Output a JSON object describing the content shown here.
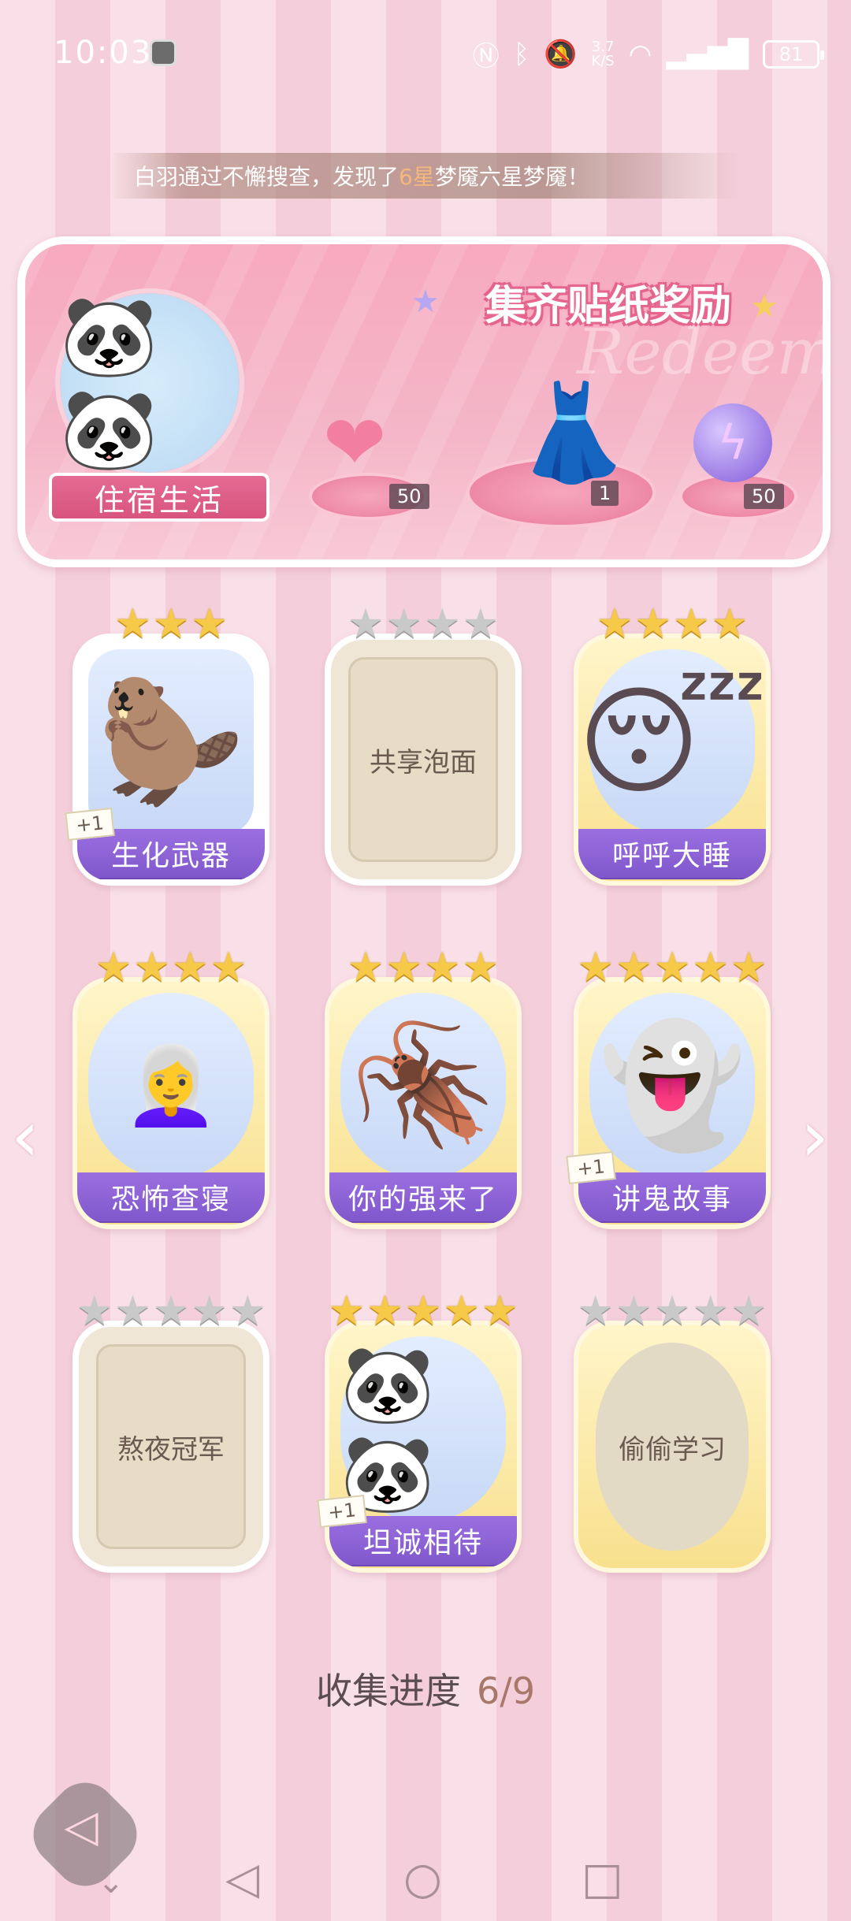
{
  "status_bar": {
    "time": "10:03",
    "network_speed_top": "3.7",
    "network_speed_bottom": "K/S",
    "battery": "81"
  },
  "notice": {
    "text_before": "白羽通过不懈搜查，发现了",
    "highlight": "6星",
    "text_after": "梦魇六星梦魇！"
  },
  "reward_panel": {
    "title": "集齐贴纸奖励",
    "watermark": "Redeem",
    "theme_label": "住宿生活",
    "items": [
      {
        "name": "heart-gem",
        "count": "50"
      },
      {
        "name": "dress",
        "count": "1"
      },
      {
        "name": "energy-orb",
        "count": "50"
      }
    ]
  },
  "cards": [
    {
      "name": "生化武器",
      "stars_on": 3,
      "stars_total": 3,
      "collected": true,
      "plus": "+1",
      "art": "🦫"
    },
    {
      "name": "共享泡面",
      "stars_on": 0,
      "stars_total": 4,
      "collected": false,
      "plus": "",
      "art": ""
    },
    {
      "name": "呼呼大睡",
      "stars_on": 4,
      "stars_total": 4,
      "collected": true,
      "plus": "",
      "art": "😴"
    },
    {
      "name": "恐怖查寝",
      "stars_on": 4,
      "stars_total": 4,
      "collected": true,
      "plus": "",
      "art": "👩‍🦳"
    },
    {
      "name": "你的强来了",
      "stars_on": 4,
      "stars_total": 4,
      "collected": true,
      "plus": "",
      "art": "🪳"
    },
    {
      "name": "讲鬼故事",
      "stars_on": 5,
      "stars_total": 5,
      "collected": true,
      "plus": "+1",
      "art": "👻"
    },
    {
      "name": "熬夜冠军",
      "stars_on": 0,
      "stars_total": 5,
      "collected": false,
      "plus": "",
      "art": ""
    },
    {
      "name": "坦诚相待",
      "stars_on": 5,
      "stars_total": 5,
      "collected": true,
      "plus": "+1",
      "art": "🐼🐼"
    },
    {
      "name": "偷偷学习",
      "stars_on": 0,
      "stars_total": 5,
      "collected": false,
      "plus": "",
      "art": ""
    }
  ],
  "progress": {
    "label": "收集进度",
    "value": "6/9"
  },
  "nav_icons": {
    "prev": "chevron-left-icon",
    "next": "chevron-right-icon",
    "back": "back-triangle-icon",
    "home": "home-circle-icon",
    "recents": "recents-square-icon"
  },
  "colors": {
    "card_label": "#8a60d6",
    "star_gold": "#f6c949",
    "star_silver": "#c9c9c9",
    "panel_pink": "#f4b6c8"
  }
}
